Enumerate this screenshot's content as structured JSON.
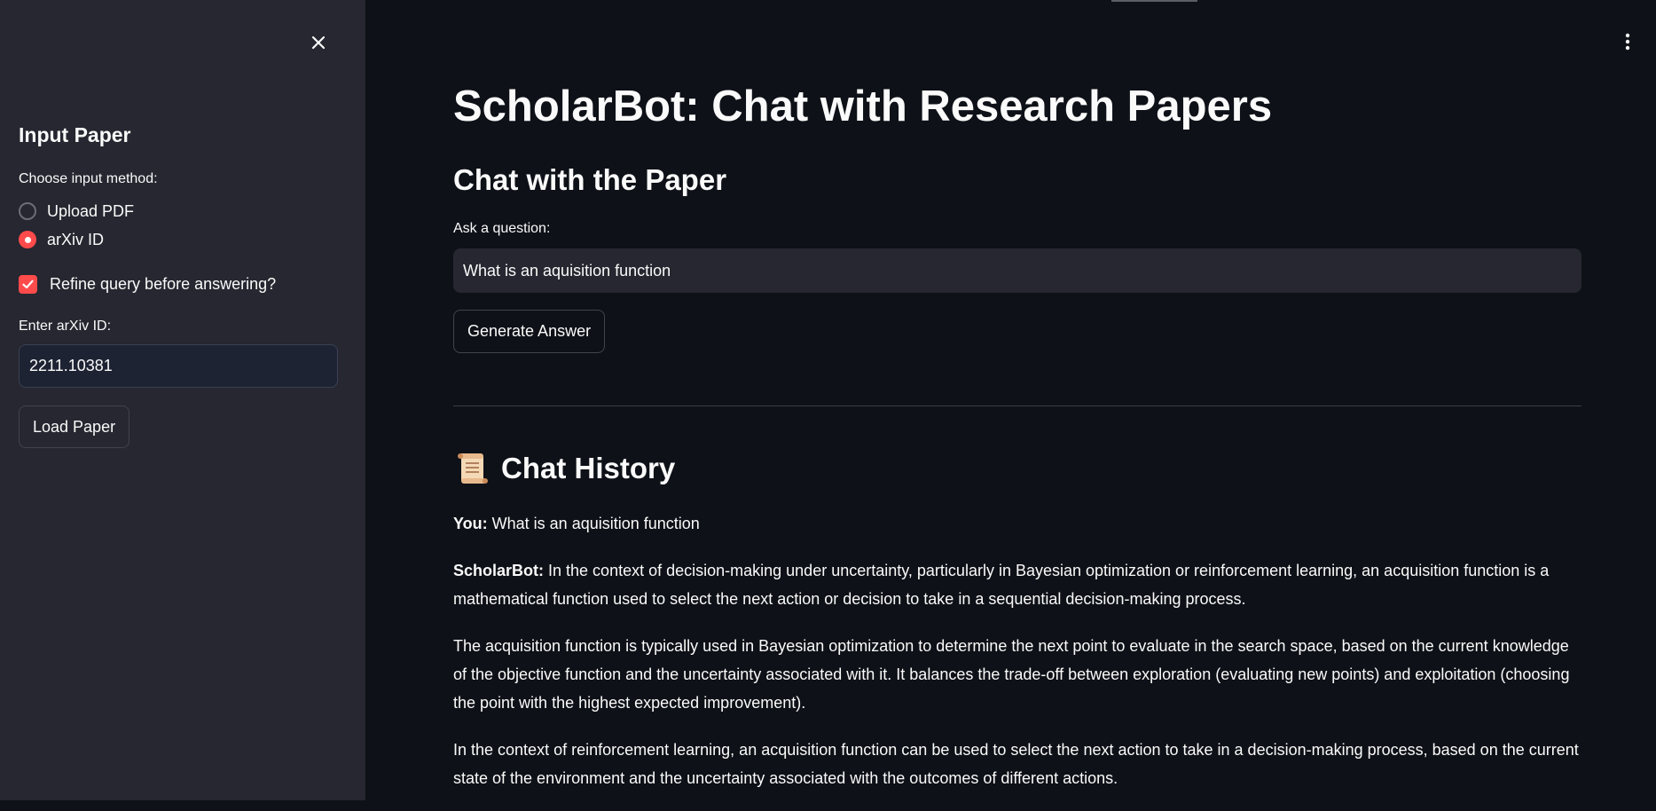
{
  "sidebar": {
    "heading": "Input Paper",
    "method_label": "Choose input method:",
    "options": [
      {
        "label": "Upload PDF",
        "selected": false
      },
      {
        "label": "arXiv ID",
        "selected": true
      }
    ],
    "refine_label": "Refine query before answering?",
    "refine_checked": true,
    "arxiv_label": "Enter arXiv ID:",
    "arxiv_value": "2211.10381",
    "load_button": "Load Paper"
  },
  "main": {
    "title": "ScholarBot: Chat with Research Papers",
    "subheader": "Chat with the Paper",
    "question_label": "Ask a question:",
    "question_value": "What is an aquisition function",
    "generate_button": "Generate Answer",
    "history_title": "Chat History",
    "chat": {
      "user_name": "You:",
      "user_message": " What is an aquisition function",
      "bot_name": "ScholarBot:",
      "bot_paragraph_1": " In the context of decision-making under uncertainty, particularly in Bayesian optimization or reinforcement learning, an acquisition function is a mathematical function used to select the next action or decision to take in a sequential decision-making process.",
      "bot_paragraph_2": "The acquisition function is typically used in Bayesian optimization to determine the next point to evaluate in the search space, based on the current knowledge of the objective function and the uncertainty associated with it. It balances the trade-off between exploration (evaluating new points) and exploitation (choosing the point with the highest expected improvement).",
      "bot_paragraph_3": "In the context of reinforcement learning, an acquisition function can be used to select the next action to take in a decision-making process, based on the current state of the environment and the uncertainty associated with the outcomes of different actions."
    }
  },
  "colors": {
    "accent": "#ff4b4b",
    "sidebar_bg": "#262730",
    "main_bg": "#0e1117"
  },
  "icons": {
    "close": "close-icon",
    "menu": "kebab-menu-icon",
    "history": "scroll-icon",
    "checkbox": "checkmark-icon"
  }
}
